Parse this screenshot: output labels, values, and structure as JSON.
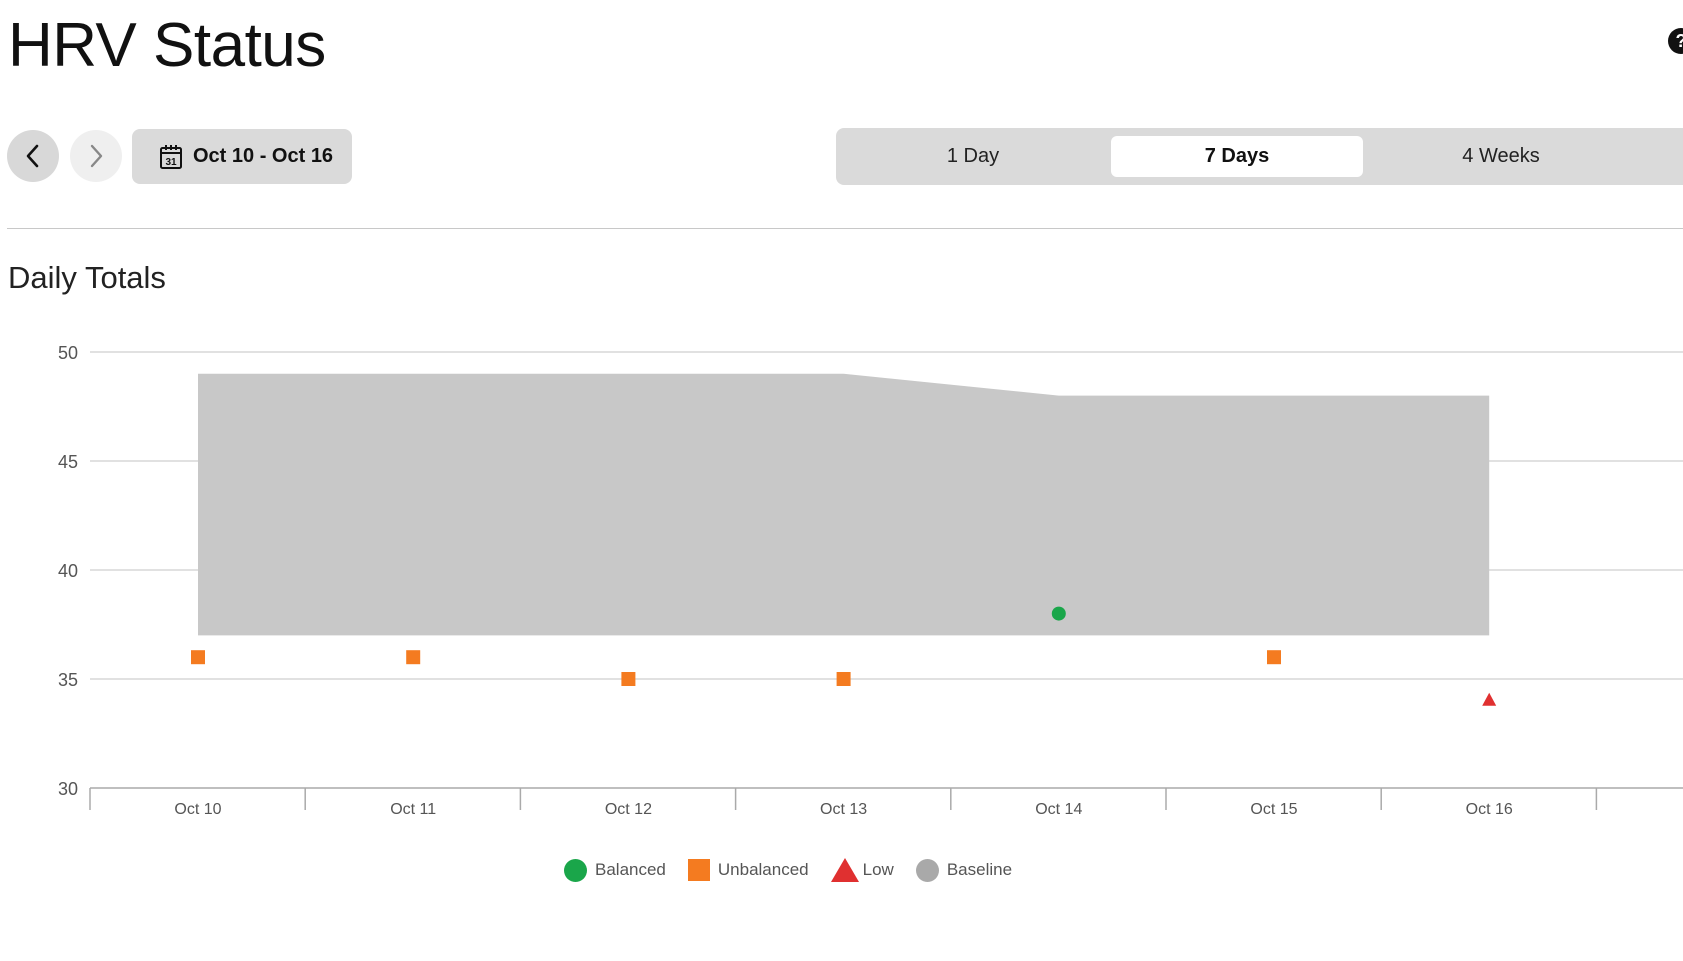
{
  "header": {
    "title": "HRV Status",
    "help_icon_glyph": "?"
  },
  "nav": {
    "prev_icon": "chevron-left-icon",
    "next_icon": "chevron-right-icon",
    "date_range_label": "Oct 10 - Oct 16",
    "calendar_icon_day": "31"
  },
  "period": {
    "tabs": [
      {
        "label": "1 Day",
        "selected": false
      },
      {
        "label": "7 Days",
        "selected": true
      },
      {
        "label": "4 Weeks",
        "selected": false
      }
    ]
  },
  "section": {
    "title": "Daily Totals"
  },
  "colors": {
    "balanced": "#1aa64a",
    "unbalanced": "#f47b20",
    "low": "#e03030",
    "baseline": "#c8c8c8",
    "baseline_legend": "#a9a9a9"
  },
  "chart_data": {
    "type": "scatter",
    "categories": [
      "Oct 10",
      "Oct 11",
      "Oct 12",
      "Oct 13",
      "Oct 14",
      "Oct 15",
      "Oct 16"
    ],
    "ylim": [
      30,
      50
    ],
    "yticks": [
      50,
      45,
      40,
      35,
      30
    ],
    "grid": true,
    "legend_position": "bottom-center",
    "baseline_band": {
      "name": "Baseline",
      "low": [
        37,
        37,
        37,
        37,
        37,
        37,
        37
      ],
      "high": [
        49,
        49,
        49,
        49,
        48,
        48,
        48
      ]
    },
    "points": [
      {
        "x": "Oct 10",
        "y": 36,
        "status": "unbalanced"
      },
      {
        "x": "Oct 11",
        "y": 36,
        "status": "unbalanced"
      },
      {
        "x": "Oct 12",
        "y": 35,
        "status": "unbalanced"
      },
      {
        "x": "Oct 13",
        "y": 35,
        "status": "unbalanced"
      },
      {
        "x": "Oct 14",
        "y": 38,
        "status": "balanced"
      },
      {
        "x": "Oct 15",
        "y": 36,
        "status": "unbalanced"
      },
      {
        "x": "Oct 16",
        "y": 34,
        "status": "low"
      }
    ],
    "legend": [
      {
        "name": "Balanced",
        "shape": "circle",
        "status": "balanced"
      },
      {
        "name": "Unbalanced",
        "shape": "square",
        "status": "unbalanced"
      },
      {
        "name": "Low",
        "shape": "triangle",
        "status": "low"
      },
      {
        "name": "Baseline",
        "shape": "circle",
        "status": "baseline"
      }
    ]
  }
}
